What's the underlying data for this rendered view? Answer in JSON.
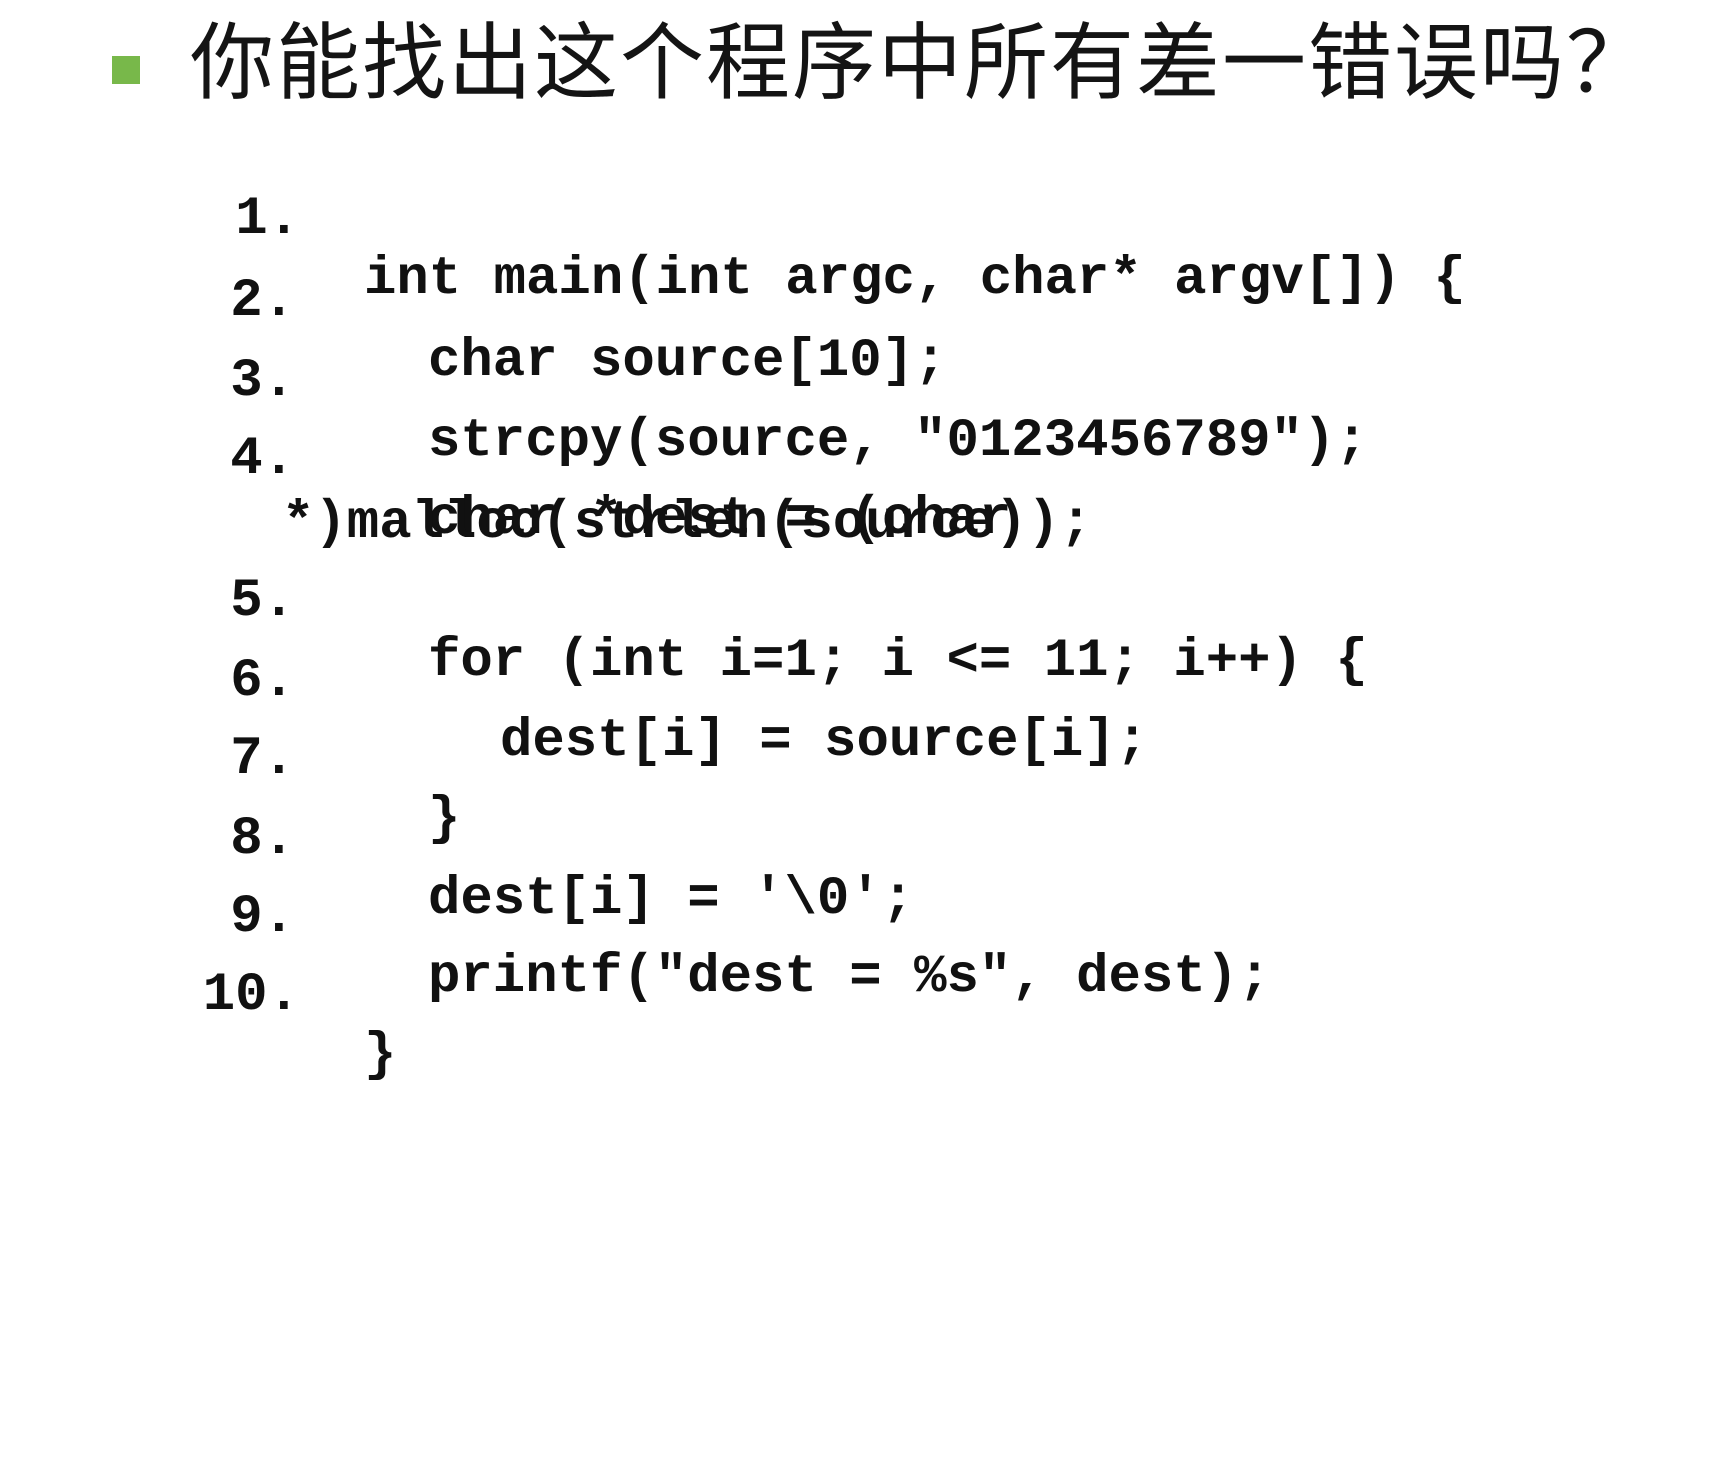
{
  "slide": {
    "bullet_color": "#78b84a",
    "title": "你能找出这个程序中所有差一错误吗？",
    "code_lines": [
      {
        "number": "1.",
        "text": "int main(int argc, char* argv[]) {"
      },
      {
        "number": "2.",
        "text": "char source[10];"
      },
      {
        "number": "3.",
        "text": "strcpy(source, \"0123456789\");"
      },
      {
        "number": "4.",
        "text": "char *dest = (char"
      },
      {
        "number": "",
        "text": "*)malloc(strlen(source));"
      },
      {
        "number": "5.",
        "text": "for (int i=1; i <= 11; i++) {"
      },
      {
        "number": "6.",
        "text": "dest[i] = source[i];"
      },
      {
        "number": "7.",
        "text": "}"
      },
      {
        "number": "8.",
        "text": "dest[i] = '\\0';"
      },
      {
        "number": "9.",
        "text": "printf(\"dest = %s\", dest);"
      },
      {
        "number": "10.",
        "text": "}"
      }
    ]
  }
}
